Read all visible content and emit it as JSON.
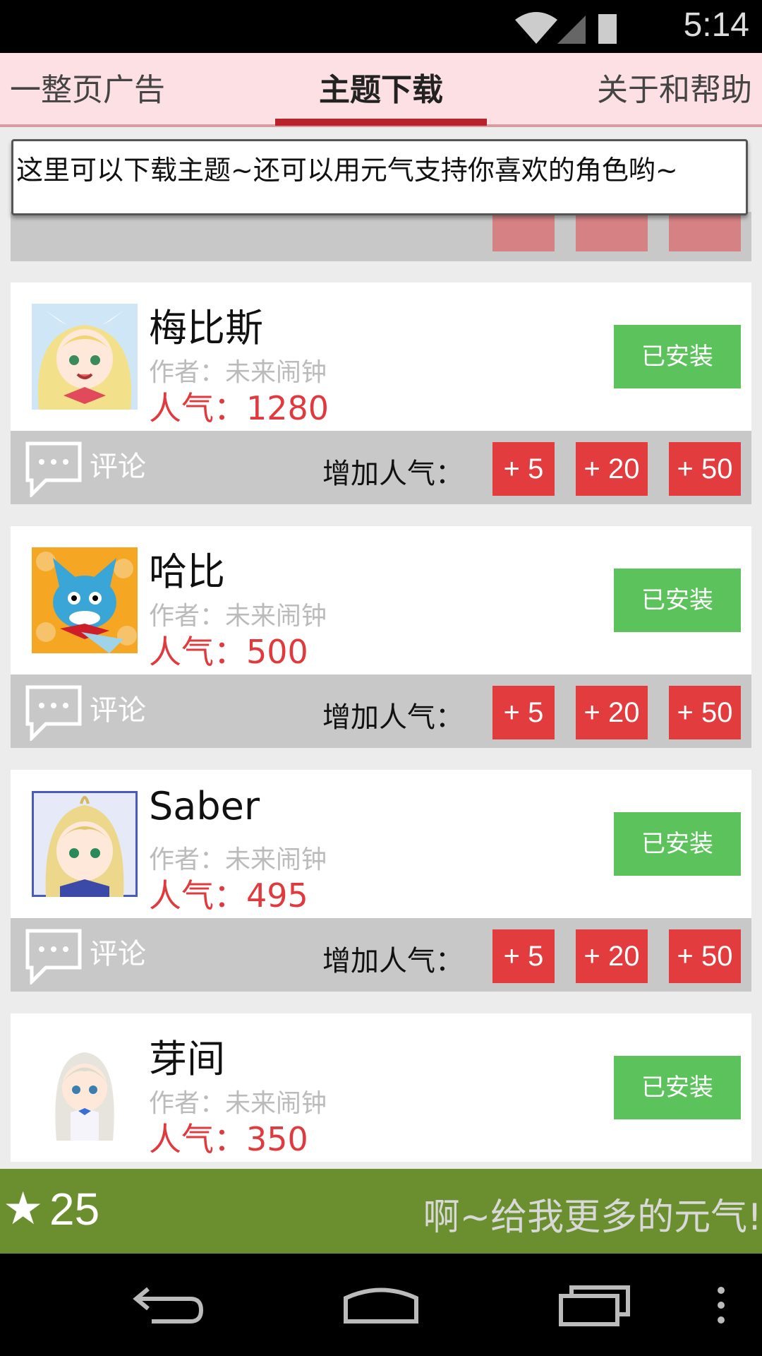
{
  "status_bar": {
    "time": "5:14"
  },
  "tabs": [
    {
      "label": "一整页广告"
    },
    {
      "label": "主题下载"
    },
    {
      "label": "关于和帮助"
    }
  ],
  "hint_text": "这里可以下载主题~还可以用元气支持你喜欢的角色哟~",
  "labels": {
    "installed": "已安装",
    "comment": "评论",
    "add_popularity": "增加人气：",
    "vote_5": "+ 5",
    "vote_20": "+ 20",
    "vote_50": "+ 50"
  },
  "themes": [
    {
      "name": "梅比斯",
      "author": "作者：未来闹钟",
      "popularity": "人气：1280"
    },
    {
      "name": "哈比",
      "author": "作者：未来闹钟",
      "popularity": "人气：500"
    },
    {
      "name": "Saber",
      "author": "作者：未来闹钟",
      "popularity": "人气：495"
    },
    {
      "name": "芽间",
      "author": "作者：未来闹钟",
      "popularity": "人气：350"
    }
  ],
  "footer": {
    "score": "25",
    "message": "啊~给我更多的元气!"
  },
  "colors": {
    "accent_red": "#e33c3f",
    "install_green": "#5cc35c",
    "footer_green": "#6b8f2e",
    "tab_bg": "#fde0e3"
  }
}
